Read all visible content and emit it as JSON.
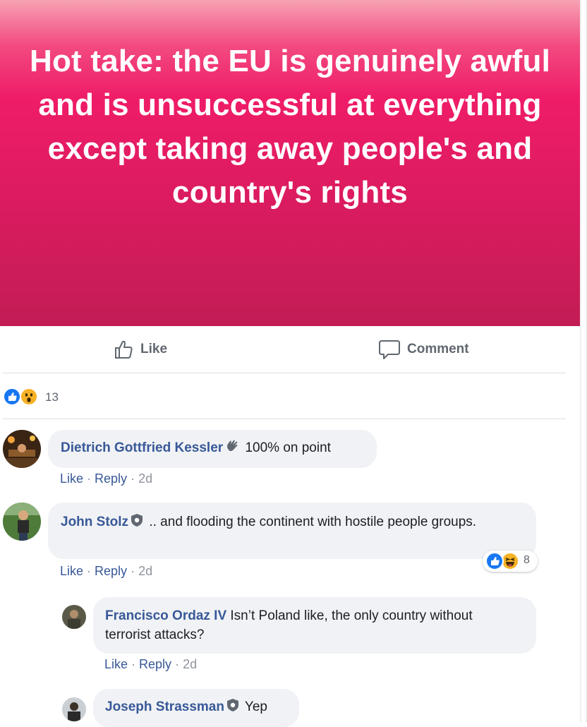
{
  "post": {
    "banner_text": "Hot take: the EU is genuinely awful and is unsuccessful at everything except taking away people's and country's rights"
  },
  "actions": {
    "like_label": "Like",
    "comment_label": "Comment"
  },
  "reactions": {
    "count": "13",
    "types": [
      "like-icon",
      "wow-icon"
    ]
  },
  "comments": [
    {
      "author": "Dietrich Gottfried Kessler",
      "badge": "wave-hand-icon",
      "text": "100% on point",
      "like": "Like",
      "reply": "Reply",
      "time": "2d"
    },
    {
      "author": "John Stolz",
      "badge": "shield-badge-icon",
      "text": ".. and flooding the continent with hostile people groups.",
      "like": "Like",
      "reply": "Reply",
      "time": "2d",
      "reaction_count": "8",
      "reaction_types": [
        "like-icon",
        "haha-icon"
      ]
    },
    {
      "author": "Francisco Ordaz IV",
      "text": "Isn’t Poland like, the only country without terrorist attacks?",
      "like": "Like",
      "reply": "Reply",
      "time": "2d"
    },
    {
      "author": "Joseph Strassman",
      "badge": "shield-badge-icon",
      "text": "Yep"
    }
  ],
  "colors": {
    "banner_top": "#f24a80",
    "banner_bottom": "#c21c55",
    "author": "#385898",
    "like_blue": "#1877f2",
    "emoji_yellow": "#f7b125"
  }
}
